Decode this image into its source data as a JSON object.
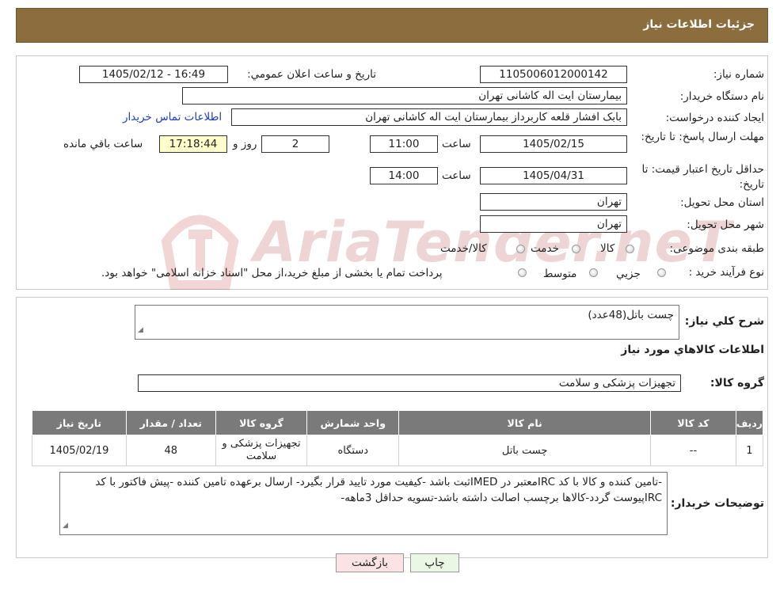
{
  "header": {
    "title": "جزئیات اطلاعات نیاز"
  },
  "form": {
    "need_number_label": "شماره نیاز:",
    "need_number": "1105006012000142",
    "announce_label": "تاریخ و ساعت اعلان عمومي:",
    "announce_value": "1405/02/12 - 16:49",
    "buyer_org_label": "نام دستگاه خريدار:",
    "buyer_org": "بیمارستان ایت اله کاشانی تهران",
    "creator_label": "ايجاد کننده درخواست:",
    "creator": "بابک افشار قلعه کاربرداز بیمارستان ایت اله کاشانی تهران",
    "contact_link": "اطلاعات تماس خريدار",
    "reply_deadline_label": "مهلت ارسال پاسخ: تا تاريخ:",
    "reply_date": "1405/02/15",
    "time_label": "ساعت",
    "reply_time": "11:00",
    "days_value": "2",
    "days_label": "روز و",
    "remaining_time": "17:18:44",
    "remaining_label": "ساعت باقي مانده",
    "price_validity_label": "حداقل تاريخ اعتبار قيمت: تا تاريخ:",
    "price_date": "1405/04/31",
    "price_time": "14:00",
    "province_label": "استان محل تحويل:",
    "province": "تهران",
    "city_label": "شهر محل تحويل:",
    "city": "تهران",
    "category_label": "طبقه بندی موضوعی:",
    "category_options": [
      "کالا",
      "خدمت",
      "کالا/خدمت"
    ],
    "process_label": "نوع فرآيند خريد :",
    "process_options": [
      "جزيي",
      "متوسط"
    ],
    "process_note": "پرداخت تمام يا بخشی از مبلغ خريد،از محل \"اسناد خزانه اسلامی\" خواهد بود."
  },
  "summary": {
    "desc_label": "شرح كلي نياز:",
    "desc_value": "چست باتل(48عدد)",
    "goods_info_title": "اطلاعات کالاهاي مورد نياز",
    "group_label": "گروه کالا:",
    "group_value": "تجهیزات پزشکی و سلامت"
  },
  "table": {
    "headers": [
      "رديف",
      "کد کالا",
      "نام کالا",
      "واحد شمارش",
      "گروه کالا",
      "تعداد / مقدار",
      "تاريخ نياز"
    ],
    "rows": [
      [
        "1",
        "--",
        "چست باتل",
        "دستگاه",
        "تجهیزات پزشکی و سلامت",
        "48",
        "1405/02/19"
      ]
    ]
  },
  "buyer_notes": {
    "label": "توضيحات خريدار:",
    "text": "-تامین کننده و کالا با کد IRCمعتبر در IMEDثبت باشد -کیفیت مورد تایید قرار بگیرد- ارسال برعهده تامین کننده -پیش فاکتور با کد IRCپیوست گردد-کالاها برچسب اصالت داشته باشد-تسویه حداقل 3ماهه-"
  },
  "buttons": {
    "print": "چاپ",
    "back": "بازگشت"
  },
  "watermark": {
    "text": "AriaTender.neT"
  },
  "colors": {
    "header_bg": "#8b6d3e",
    "table_header_bg": "#7a7a7a",
    "yellow_box": "#ffffcc",
    "print_btn": "#eaf7e4",
    "back_btn": "#fbe3e3"
  }
}
